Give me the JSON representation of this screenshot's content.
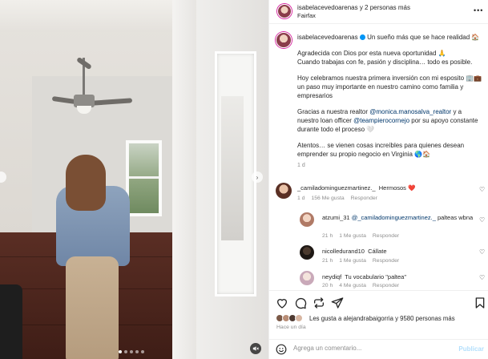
{
  "header": {
    "names": "isabelacevedoarenas y 2 personas más",
    "location": "Fairfax"
  },
  "caption": {
    "username": "isabelacevedoarenas",
    "headline": "Un sueño más que se hace realidad 🏠",
    "para1_line1": "Agradecida con Dios por esta nueva oportunidad 🙏",
    "para1_line2": "Cuando trabajas con fe, pasión y disciplina… todo es posible.",
    "para2": "Hoy celebramos nuestra primera inversión con mi esposito 🏢💼 un paso muy importante en nuestro camino como familia y empresarios",
    "para3_a": "Gracias a nuestra realtor ",
    "mention1": "@monica.manosalva_realtor",
    "para3_b": " y a nuestro loan officer ",
    "mention2": "@teampierocornejo",
    "para3_c": " por su apoyo constante durante todo el proceso 🤍",
    "para4": "Atentos… se vienen cosas increíbles para quienes desean emprender su propio negocio en Virginia 🌎🏠",
    "time": "1 d"
  },
  "comments": [
    {
      "username": "_camiladominguezmartinez._",
      "text": "Hermosos ❤️",
      "time": "1 d",
      "likes": "156 Me gusta",
      "reply": "Responder"
    },
    {
      "username": "atzumi_31",
      "mention": "@_camiladominguezmartinez._",
      "text": "palteas wbna",
      "time": "21 h",
      "likes": "1 Me gusta",
      "reply": "Responder"
    },
    {
      "username": "nicolledurand10",
      "text": "Cállate",
      "time": "21 h",
      "likes": "1 Me gusta",
      "reply": "Responder"
    },
    {
      "username": "neydiqf",
      "text": "Tu vocabulario \"paltea\"",
      "time": "20 h",
      "likes": "4 Me gusta",
      "reply": "Responder"
    }
  ],
  "likes": {
    "text_prefix": "Les gusta a ",
    "user": "alejandrabaigorria",
    "text_suffix": " y 9580 personas más"
  },
  "posted": "Hace un día",
  "comment_box": {
    "placeholder": "Agrega un comentario...",
    "post_label": "Publicar"
  },
  "colors": {
    "link": "#00376b",
    "muted": "#8e8e8e",
    "accent": "#0095f6"
  }
}
